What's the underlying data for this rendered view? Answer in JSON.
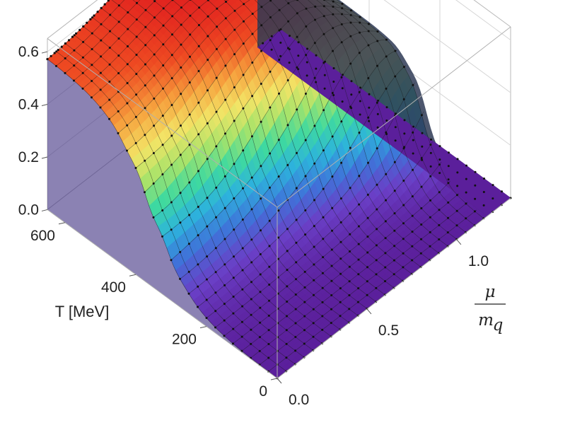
{
  "chart_data": {
    "type": "surface3d",
    "title": "",
    "x_axis": {
      "label_numerator": "μ",
      "label_denominator": "m",
      "label_denominator_sub": "q",
      "range": [
        0,
        1.3
      ],
      "ticks": [
        "0.0",
        "0.5",
        "1.0"
      ]
    },
    "y_axis": {
      "label": "T [MeV]",
      "range": [
        0,
        650
      ],
      "ticks": [
        "0",
        "200",
        "400",
        "600"
      ]
    },
    "z_axis": {
      "label": "",
      "range": [
        0,
        0.65
      ],
      "ticks": [
        "0.0",
        "0.2",
        "0.4",
        "0.6"
      ]
    },
    "colormap": [
      "#5b1f9b",
      "#6a3fc6",
      "#3f73d9",
      "#2db3dc",
      "#3ed9a0",
      "#a6e36a",
      "#f3e466",
      "#f6a23e",
      "#ee4a22",
      "#e01f1f"
    ],
    "grid_T": [
      0,
      25,
      50,
      75,
      100,
      125,
      150,
      175,
      200,
      225,
      250,
      275,
      300,
      325,
      350,
      375,
      400,
      425,
      450,
      475,
      500,
      525,
      550,
      575,
      600,
      625,
      650
    ],
    "grid_mu": [
      0.0,
      0.05,
      0.1,
      0.15,
      0.2,
      0.25,
      0.3,
      0.35,
      0.4,
      0.45,
      0.5,
      0.55,
      0.6,
      0.65,
      0.7,
      0.75,
      0.8,
      0.85,
      0.9,
      0.95,
      1.0,
      1.05,
      1.1,
      1.15,
      1.2,
      1.25,
      1.3
    ],
    "surface_summary": {
      "value_at_T650_mu0": 0.57,
      "value_at_T650_mu_1.15": 0.32,
      "peak_value": 0.64,
      "peak_location": {
        "T": 650,
        "mu": 0.55
      },
      "low_region_value": 0.0,
      "transition_T_range": [
        250,
        450
      ],
      "critical_mu": 1.17
    },
    "grid": true,
    "box": true
  }
}
